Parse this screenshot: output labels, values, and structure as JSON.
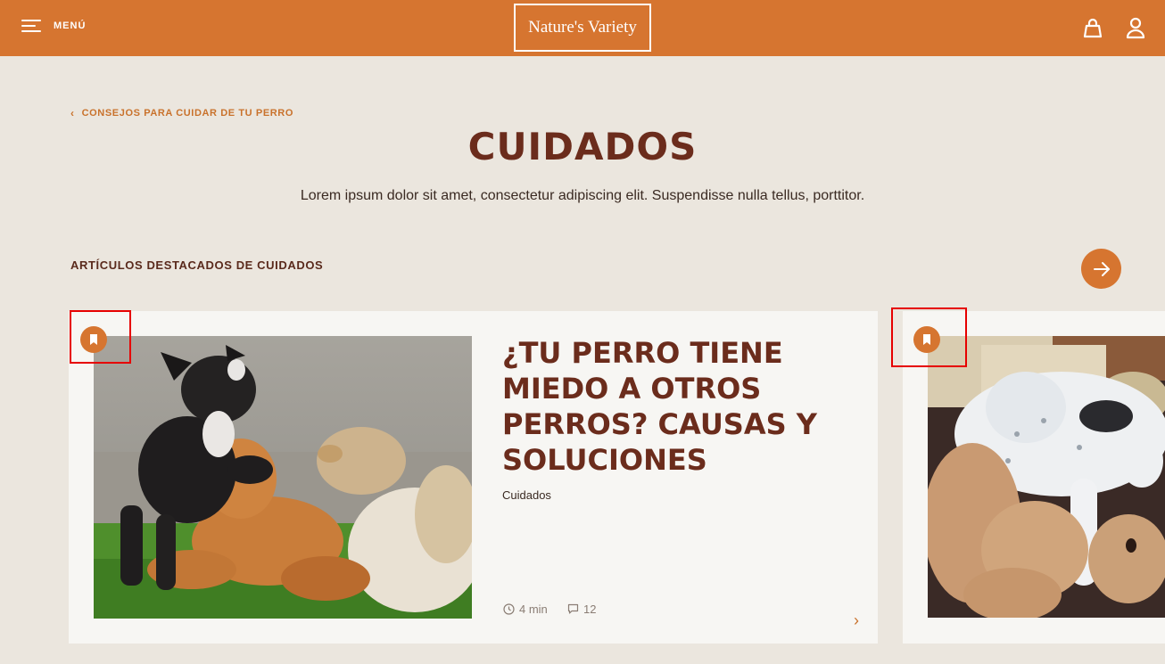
{
  "header": {
    "menu_label": "MENÚ",
    "logo_text": "Nature's Variety"
  },
  "breadcrumb": "CONSEJOS PARA CUIDAR DE TU PERRO",
  "page": {
    "title": "CUIDADOS",
    "description": "Lorem ipsum dolor sit amet, consectetur adipiscing elit. Suspendisse nulla tellus, porttitor."
  },
  "featured": {
    "section_title": "ARTÍCULOS DESTACADOS DE CUIDADOS",
    "cards": [
      {
        "title": "¿TU PERRO TIENE MIEDO A OTROS PERROS? CAUSAS Y SOLUCIONES",
        "category": "Cuidados",
        "read_time": "4 min",
        "comments": "12"
      }
    ]
  },
  "colors": {
    "brand_orange": "#d67530",
    "title_brown": "#6b2c1c",
    "background": "#ebe6de",
    "highlight_red": "#e60000"
  }
}
